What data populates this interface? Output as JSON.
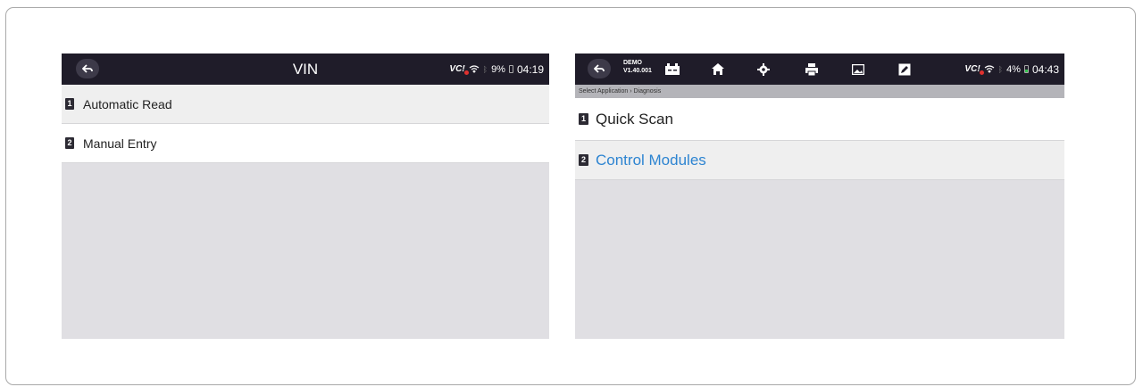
{
  "left_screen": {
    "title": "VIN",
    "status": {
      "vci": "VC",
      "battery": "9%",
      "time": "04:19"
    },
    "items": [
      {
        "num": "1",
        "label": "Automatic Read"
      },
      {
        "num": "2",
        "label": "Manual Entry"
      }
    ]
  },
  "right_screen": {
    "demo_line1": "DEMO",
    "demo_line2": "V1.40.001",
    "status": {
      "vci": "VC",
      "battery": "4%",
      "time": "04:43"
    },
    "breadcrumb": "Select Application › Diagnosis",
    "items": [
      {
        "num": "1",
        "label": "Quick Scan"
      },
      {
        "num": "2",
        "label": "Control Modules"
      }
    ]
  },
  "colors": {
    "bar": "#1f1c29",
    "selected_text": "#2d84d1",
    "panel_bg": "#e0dfe3"
  },
  "icons": [
    "back-arrow-icon",
    "wifi-icon",
    "bluetooth-icon",
    "battery-icon",
    "car-battery-icon",
    "home-icon",
    "gear-icon",
    "printer-icon",
    "image-icon",
    "edit-icon"
  ]
}
